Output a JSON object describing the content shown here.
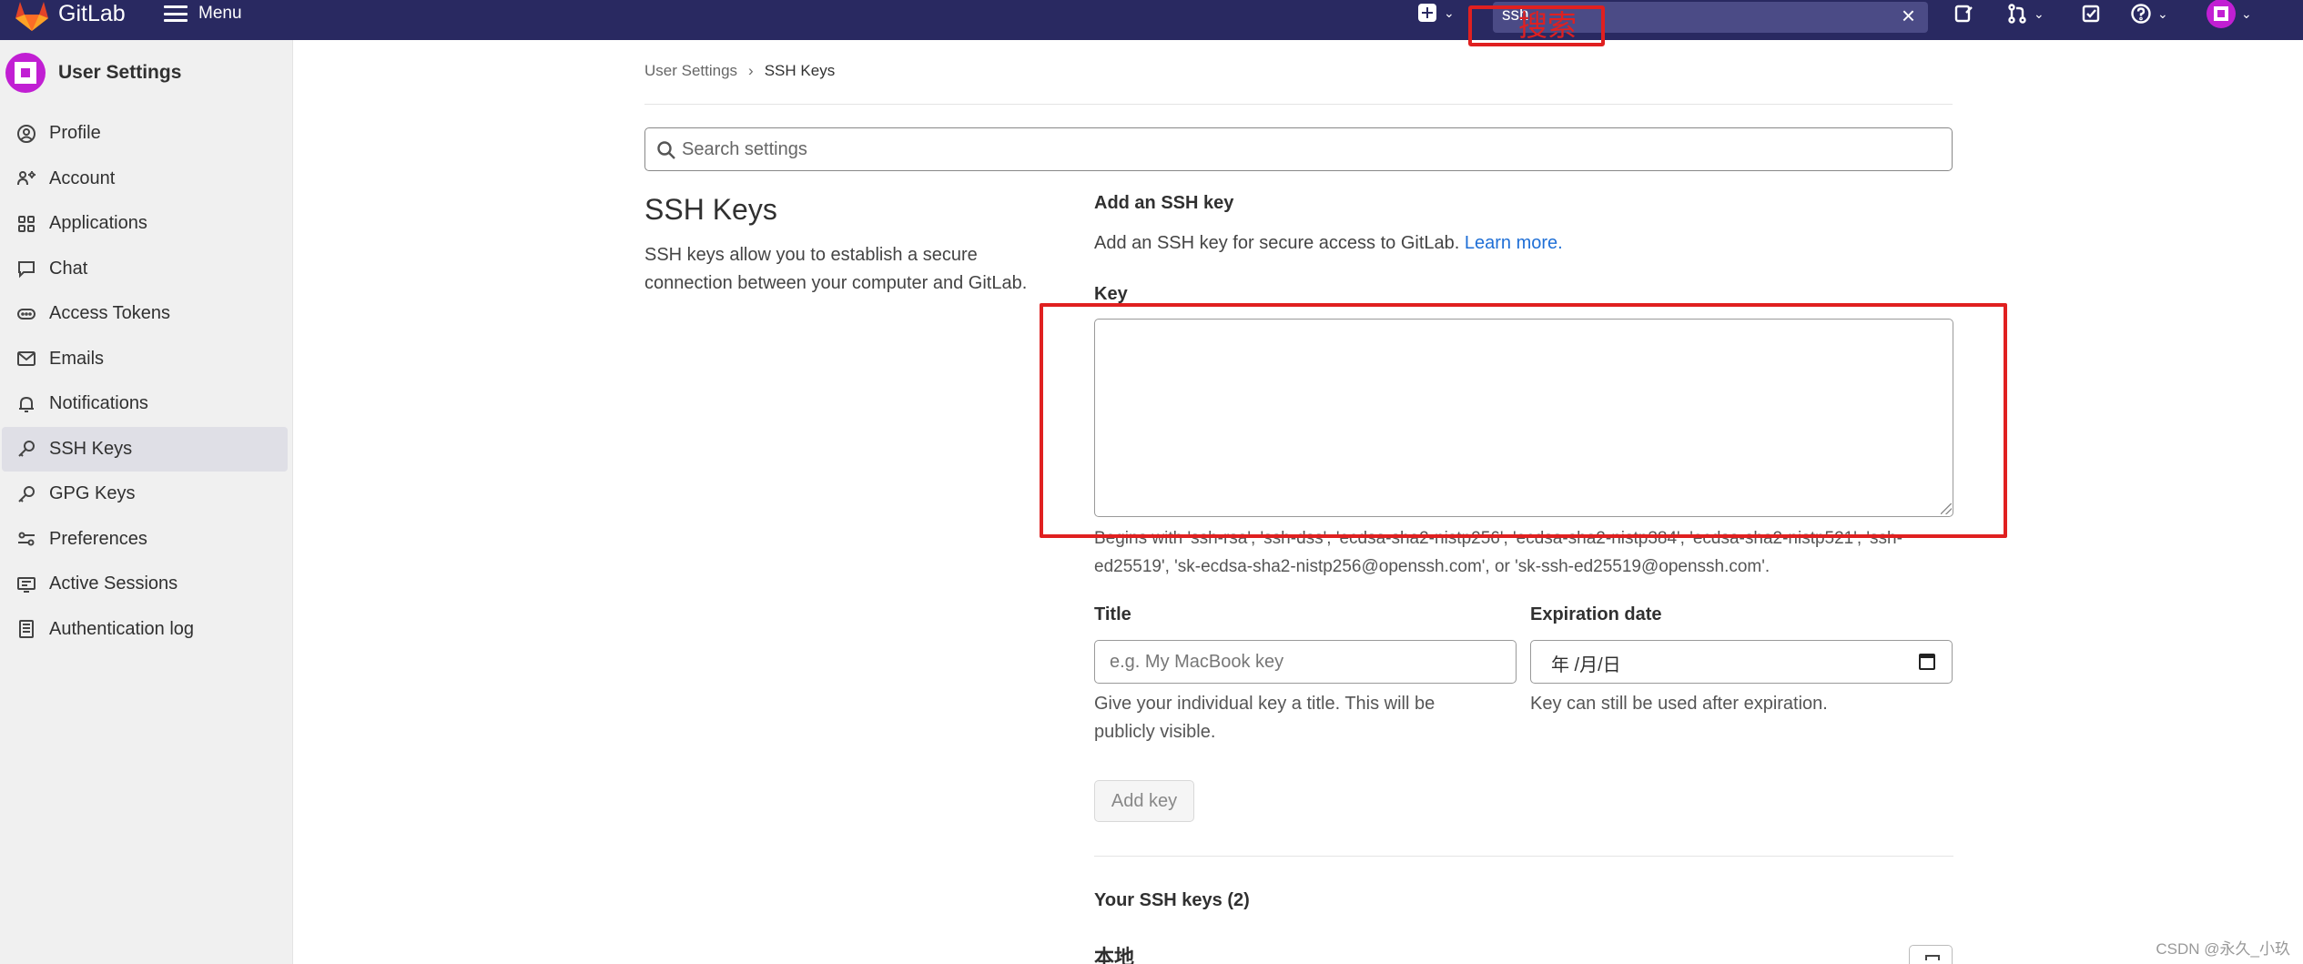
{
  "topbar": {
    "brand": "GitLab",
    "menu_label": "Menu",
    "search_value": "ssh",
    "annotation_label": "搜索"
  },
  "sidebar": {
    "title": "User Settings",
    "items": [
      {
        "label": "Profile",
        "icon": "profile-icon"
      },
      {
        "label": "Account",
        "icon": "account-icon"
      },
      {
        "label": "Applications",
        "icon": "applications-icon"
      },
      {
        "label": "Chat",
        "icon": "chat-icon"
      },
      {
        "label": "Access Tokens",
        "icon": "token-icon"
      },
      {
        "label": "Emails",
        "icon": "mail-icon"
      },
      {
        "label": "Notifications",
        "icon": "bell-icon"
      },
      {
        "label": "SSH Keys",
        "icon": "key-icon",
        "active": true
      },
      {
        "label": "GPG Keys",
        "icon": "key-icon"
      },
      {
        "label": "Preferences",
        "icon": "preferences-icon"
      },
      {
        "label": "Active Sessions",
        "icon": "monitor-icon"
      },
      {
        "label": "Authentication log",
        "icon": "log-icon"
      }
    ]
  },
  "breadcrumb": {
    "parent": "User Settings",
    "separator": "›",
    "current": "SSH Keys"
  },
  "settings_search": {
    "placeholder": "Search settings"
  },
  "section": {
    "title": "SSH Keys",
    "description": "SSH keys allow you to establish a secure connection between your computer and GitLab."
  },
  "form": {
    "heading": "Add an SSH key",
    "description": "Add an SSH key for secure access to GitLab.",
    "learn_more": "Learn more.",
    "key_label": "Key",
    "key_help": "Begins with 'ssh-rsa', 'ssh-dss', 'ecdsa-sha2-nistp256', 'ecdsa-sha2-nistp384', 'ecdsa-sha2-nistp521', 'ssh-ed25519', 'sk-ecdsa-sha2-nistp256@openssh.com', or 'sk-ssh-ed25519@openssh.com'.",
    "title_label": "Title",
    "title_placeholder": "e.g. My MacBook key",
    "title_help": "Give your individual key a title. This will be publicly visible.",
    "expiration_label": "Expiration date",
    "expiration_placeholder": "年 /月/日",
    "expiration_help": "Key can still be used after expiration.",
    "submit_label": "Add key"
  },
  "keys_list": {
    "heading": "Your SSH keys (2)",
    "first_key_name": "本地"
  },
  "watermark": "CSDN @永久_小玖",
  "colors": {
    "topbar": "#292961",
    "annotation": "#e02020",
    "link": "#1f6fd6",
    "avatar": "#c11fd3"
  }
}
